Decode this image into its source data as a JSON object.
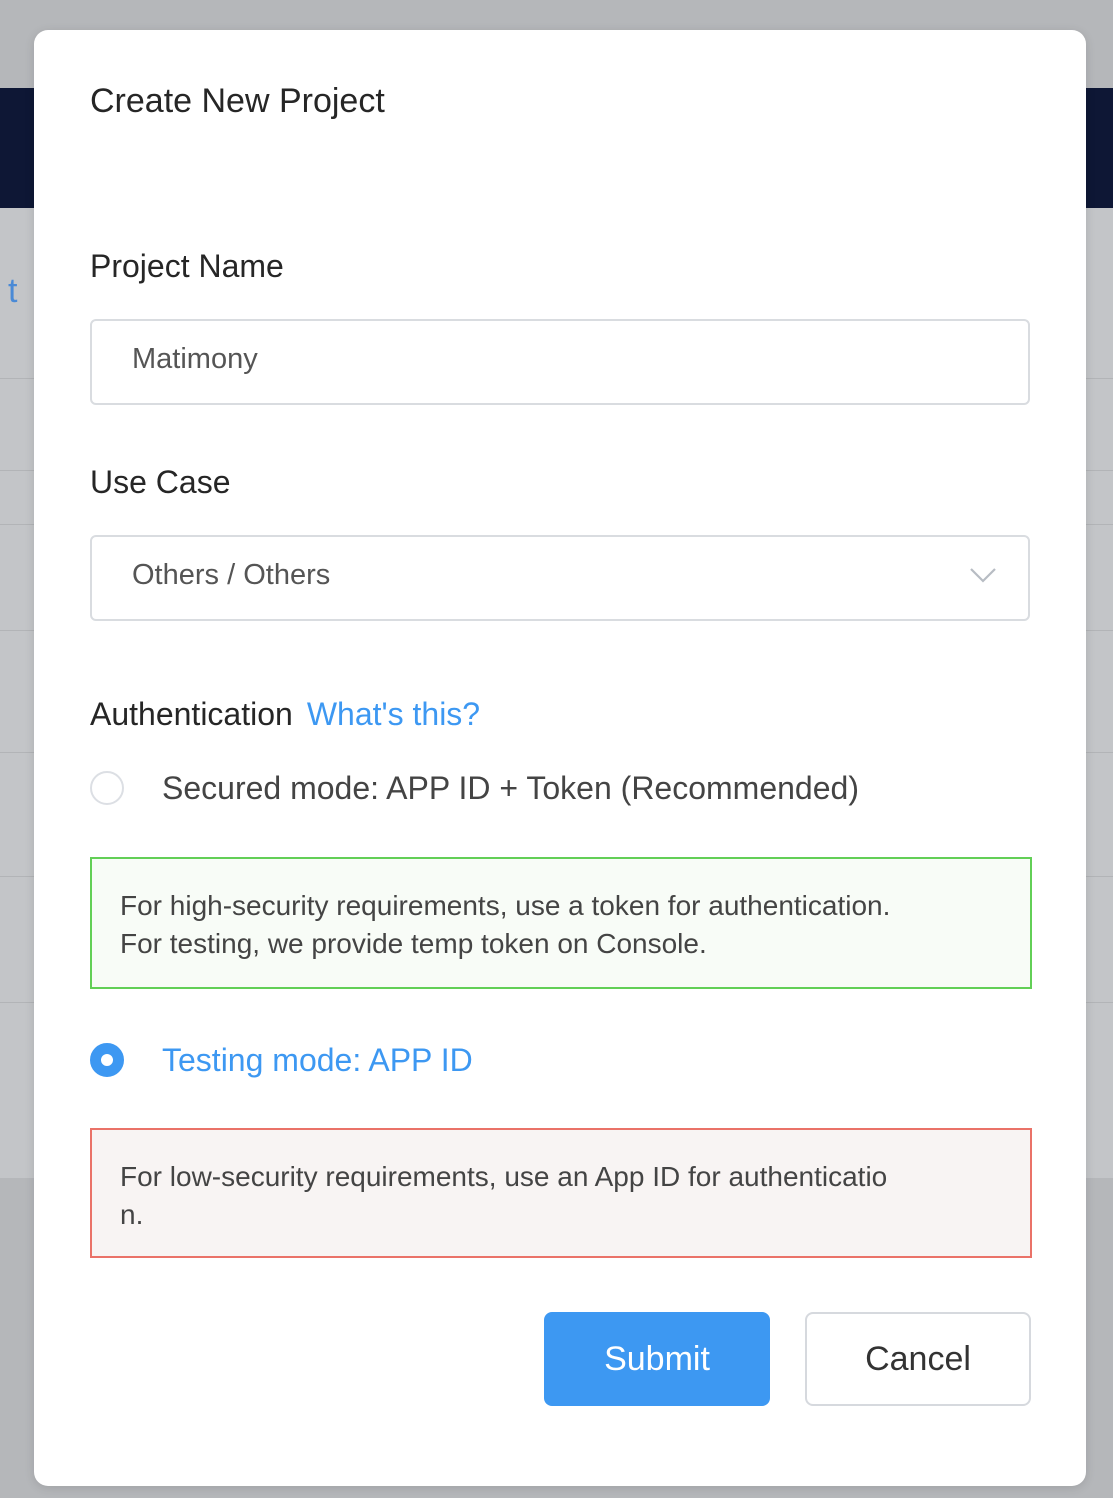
{
  "background": {
    "partial_link_text": "t"
  },
  "modal": {
    "title": "Create New Project",
    "project_name": {
      "label": "Project Name",
      "value": "Matimony"
    },
    "use_case": {
      "label": "Use Case",
      "selected": "Others / Others"
    },
    "authentication": {
      "label": "Authentication",
      "help_link": "What's this?",
      "options": [
        {
          "label": "Secured mode: APP ID + Token (Recommended)",
          "checked": false,
          "note_line1": "For high-security requirements, use a token for authentication.",
          "note_line2": "For testing, we provide temp token on Console."
        },
        {
          "label": "Testing mode: APP ID",
          "checked": true,
          "note_line1": "For low-security requirements, use an App ID for authenticatio",
          "note_line2": "n."
        }
      ]
    },
    "buttons": {
      "submit": "Submit",
      "cancel": "Cancel"
    }
  },
  "colors": {
    "accent": "#3d98f2",
    "navbar": "#0e1735",
    "note_green_border": "#62cf56",
    "note_red_border": "#ea7268"
  }
}
